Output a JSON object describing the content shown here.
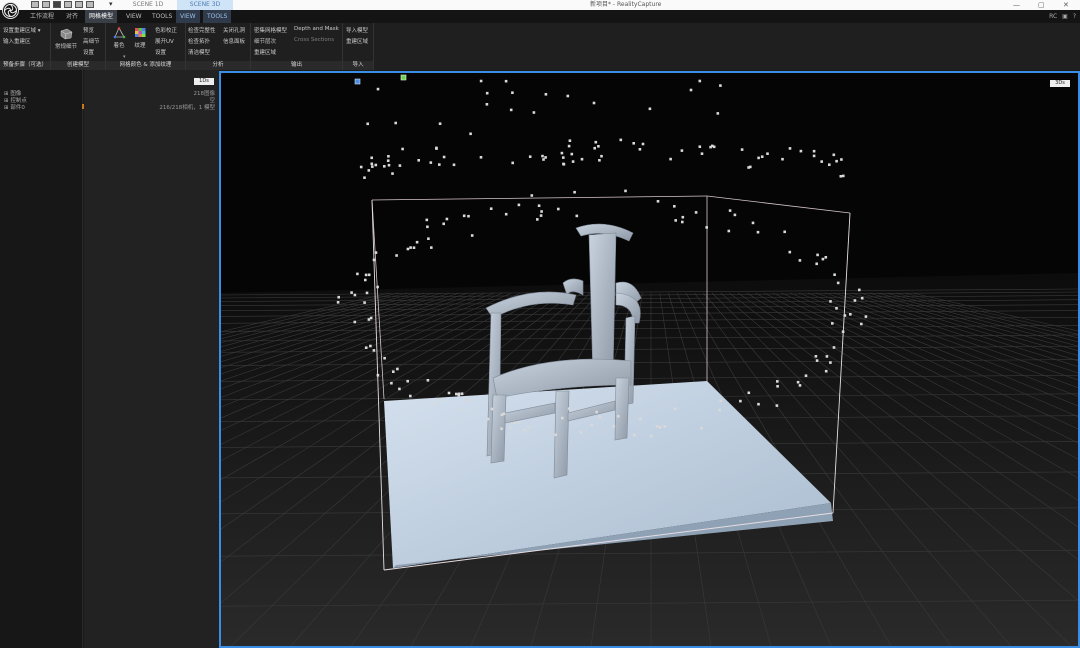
{
  "titlebar": {
    "scene_1d": "SCENE 1D",
    "scene_3d": "SCENE 3D",
    "window_title": "新项目* - RealityCapture",
    "minimize": "—",
    "maximize": "▢",
    "close": "✕"
  },
  "menu": {
    "workflow": "工作流程",
    "align": "对齐",
    "mesh_model": "网格模型",
    "view": "VIEW",
    "tools": "TOOLS",
    "view2": "VIEW",
    "tools2": "TOOLS",
    "right_rc": "RC",
    "right_help": "?"
  },
  "ribbon": {
    "g1": {
      "caption": "预备步骤（可选）",
      "item1": "设置重建区域",
      "item2": "输入重建区"
    },
    "g2": {
      "caption": "创建模型",
      "big": "常规细节",
      "item1": "预览",
      "item2": "高细节",
      "item3": "设置"
    },
    "g3": {
      "caption": "网格颜色 & 添加纹理",
      "big1": "着色",
      "big2": "纹理",
      "item1": "色彩校正",
      "item2": "展开UV",
      "item3": "设置"
    },
    "g4": {
      "caption": "分析",
      "c1r1": "检查完整性",
      "c1r2": "检查拓扑",
      "c1r3": "清洁模型",
      "c2r1": "关闭孔洞",
      "c2r2": "信息面板"
    },
    "g5": {
      "caption": "输出",
      "c1r1": "密集网格模型",
      "c1r2": "细节层次",
      "c1r3": "重建区域",
      "c2r1": "Depth and Mask",
      "c2r2": "Cross Sections"
    },
    "g6": {
      "caption": "导入",
      "item1": "导入模型",
      "item2": "重建区域"
    }
  },
  "left_panel": {
    "tree": [
      "图像",
      "控制点",
      "部件0"
    ]
  },
  "mid_panel": {
    "tag": "1Ds",
    "rows": [
      {
        "value": "218图像"
      },
      {
        "value": "空"
      },
      {
        "value": "216/218相机，1 模型"
      }
    ]
  },
  "viewport": {
    "tag": "3Ds"
  },
  "colors": {
    "accent": "#3a8ee6",
    "model": "#b8c6d6",
    "camera_marker": "#dcdcdc"
  }
}
